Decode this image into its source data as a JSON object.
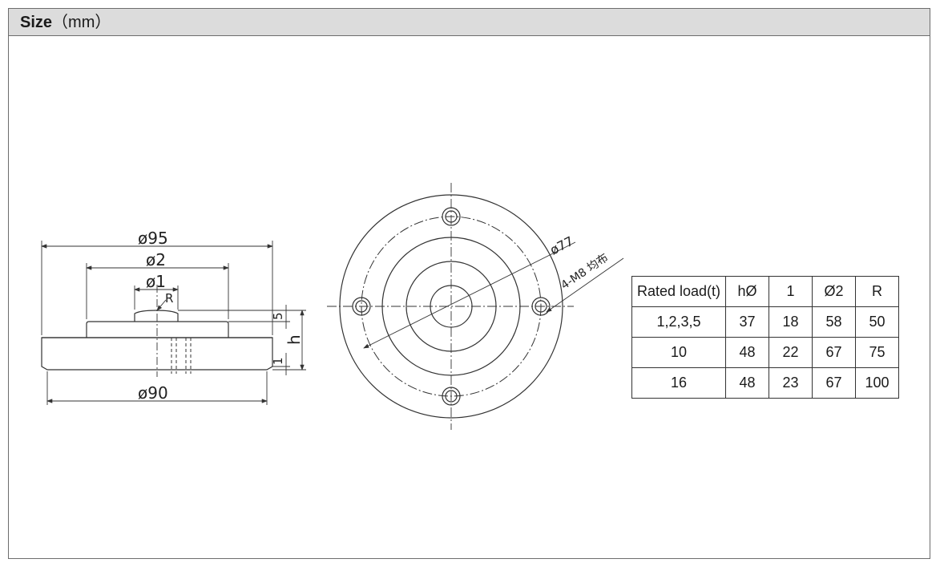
{
  "header": {
    "title": "Size",
    "unit": "（mm）"
  },
  "drawing": {
    "side_view": {
      "dim_outer_diameter": "ø95",
      "dim_d2": "ø2",
      "dim_d1": "ø1",
      "dim_r": "R",
      "dim_5": "5",
      "dim_h": "h",
      "dim_1": "1",
      "dim_bottom_diameter": "ø90"
    },
    "top_view": {
      "dim_pcd": "ø77",
      "dim_holes": "4-M8 均布"
    }
  },
  "table": {
    "headers": [
      "Rated load(t)",
      "hØ",
      "1",
      "Ø2",
      "R"
    ],
    "rows": [
      [
        "1,2,3,5",
        "37",
        "18",
        "58",
        "50"
      ],
      [
        "10",
        "48",
        "22",
        "67",
        "75"
      ],
      [
        "16",
        "48",
        "23",
        "67",
        "100"
      ]
    ]
  },
  "colors": {
    "header_bg": "#dcdcdc",
    "line": "#333333",
    "frame": "#6d6d6d"
  }
}
